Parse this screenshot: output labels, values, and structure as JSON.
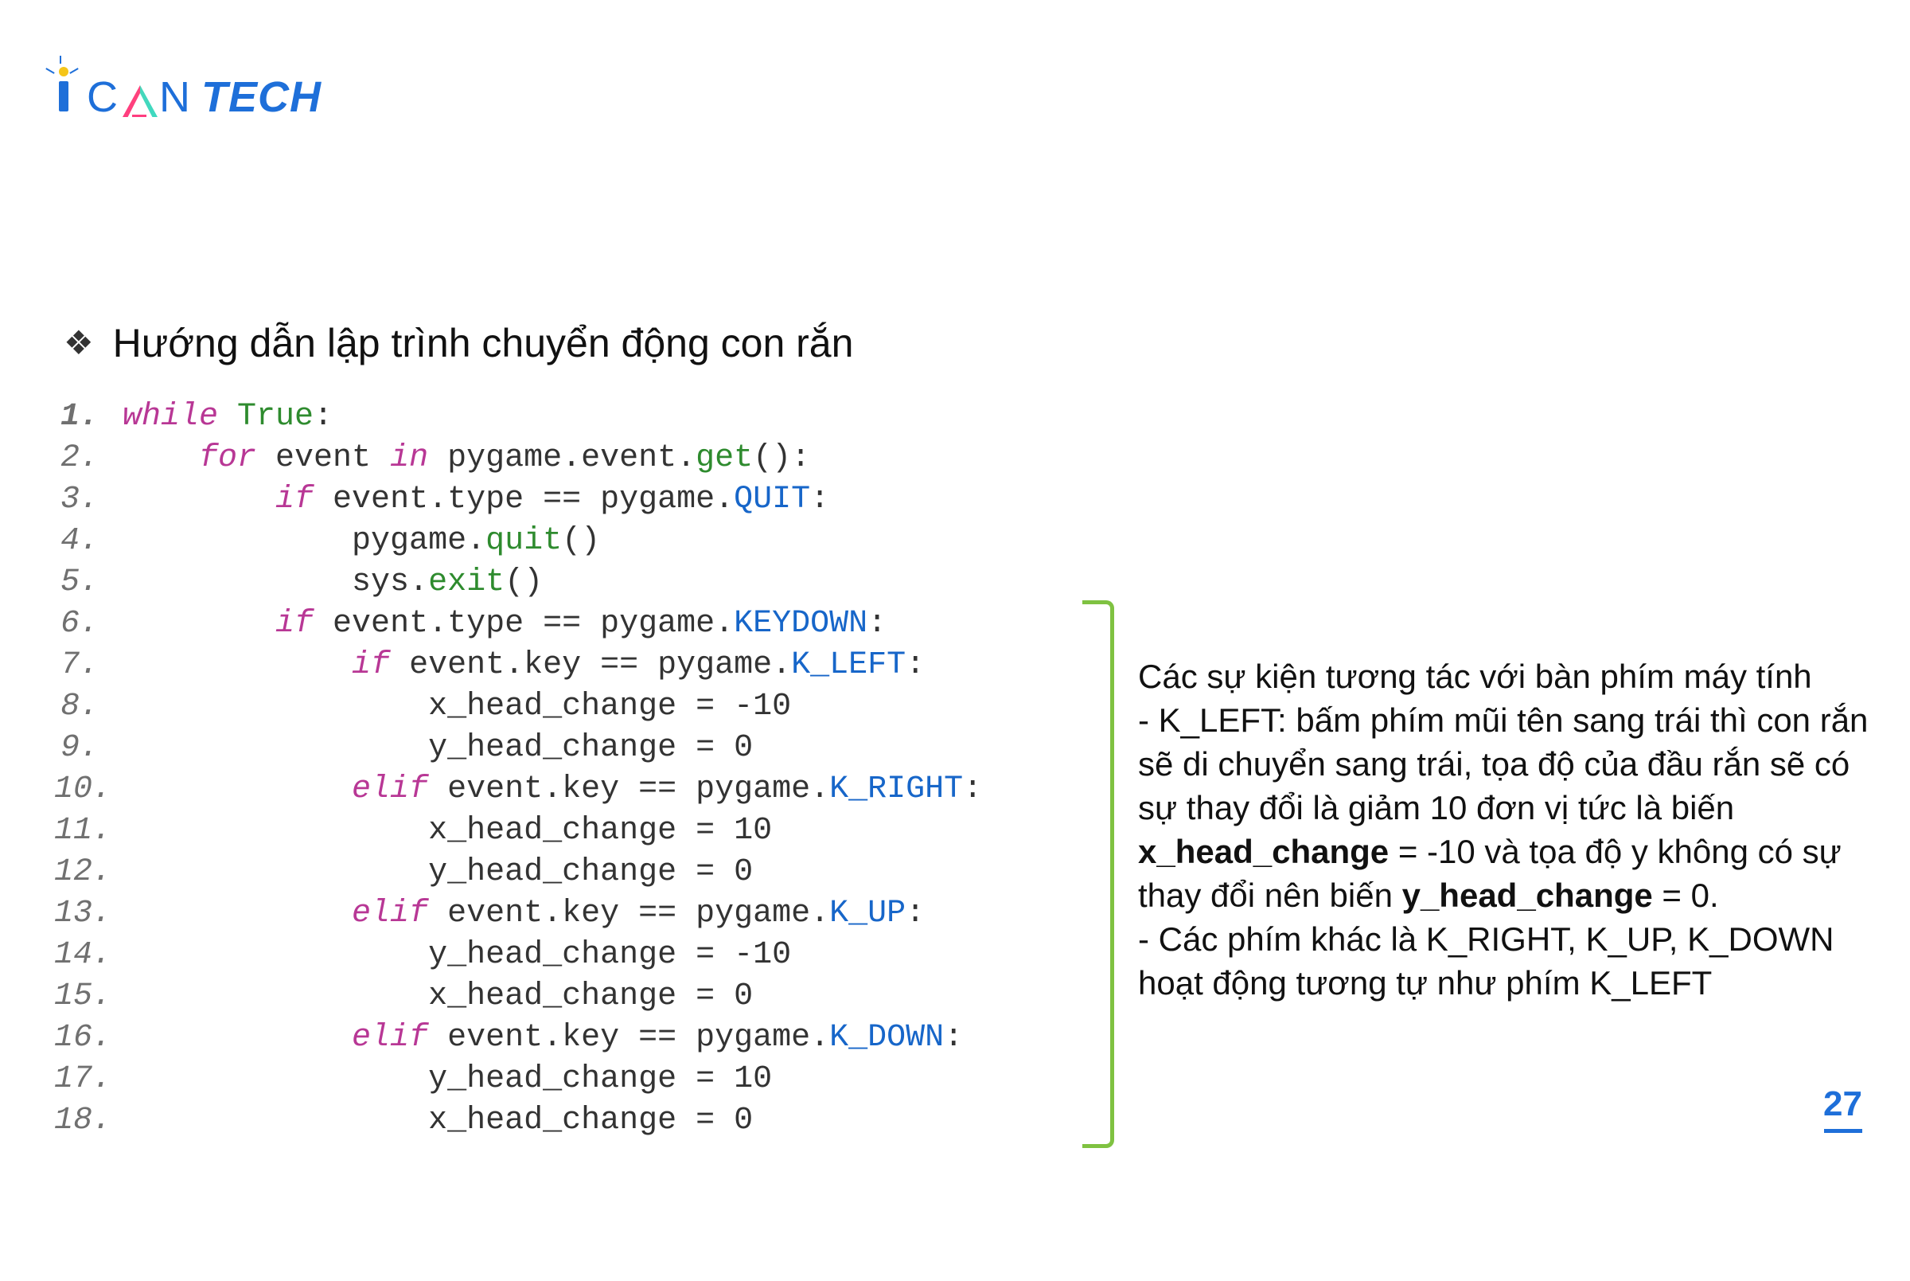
{
  "logo": {
    "can": "CAN",
    "tech": "TECH"
  },
  "heading": "Hướng dẫn lập trình chuyển động con rắn",
  "code": {
    "lines": [
      {
        "n": "1.",
        "bold": true,
        "tokens": [
          [
            "kw",
            "while"
          ],
          [
            "",
            " "
          ],
          [
            "bool",
            "True"
          ],
          [
            "",
            ":"
          ]
        ]
      },
      {
        "n": "2.",
        "bold": false,
        "tokens": [
          [
            "",
            "    "
          ],
          [
            "kw",
            "for"
          ],
          [
            "",
            " event "
          ],
          [
            "kw",
            "in"
          ],
          [
            "",
            " pygame.event."
          ],
          [
            "fn",
            "get"
          ],
          [
            "",
            "():"
          ]
        ]
      },
      {
        "n": "3.",
        "bold": false,
        "tokens": [
          [
            "",
            "        "
          ],
          [
            "kw",
            "if"
          ],
          [
            "",
            " event.type == pygame."
          ],
          [
            "const",
            "QUIT"
          ],
          [
            "",
            ":"
          ]
        ]
      },
      {
        "n": "4.",
        "bold": false,
        "tokens": [
          [
            "",
            "            pygame."
          ],
          [
            "fn",
            "quit"
          ],
          [
            "",
            "()"
          ]
        ]
      },
      {
        "n": "5.",
        "bold": false,
        "tokens": [
          [
            "",
            "            sys."
          ],
          [
            "fn",
            "exit"
          ],
          [
            "",
            "()"
          ]
        ]
      },
      {
        "n": "6.",
        "bold": false,
        "tokens": [
          [
            "",
            "        "
          ],
          [
            "kw",
            "if"
          ],
          [
            "",
            " event.type == pygame."
          ],
          [
            "const",
            "KEYDOWN"
          ],
          [
            "",
            ":"
          ]
        ]
      },
      {
        "n": "7.",
        "bold": false,
        "tokens": [
          [
            "",
            "            "
          ],
          [
            "kw",
            "if"
          ],
          [
            "",
            " event.key == pygame."
          ],
          [
            "const",
            "K_LEFT"
          ],
          [
            "",
            ":"
          ]
        ]
      },
      {
        "n": "8.",
        "bold": false,
        "tokens": [
          [
            "",
            "                x_head_change = "
          ],
          [
            "num",
            "-10"
          ]
        ]
      },
      {
        "n": "9.",
        "bold": false,
        "tokens": [
          [
            "",
            "                y_head_change = "
          ],
          [
            "num",
            "0"
          ]
        ]
      },
      {
        "n": "10.",
        "bold": false,
        "tokens": [
          [
            "",
            "            "
          ],
          [
            "kw",
            "elif"
          ],
          [
            "",
            " event.key == pygame."
          ],
          [
            "const",
            "K_RIGHT"
          ],
          [
            "",
            ":"
          ]
        ]
      },
      {
        "n": "11.",
        "bold": false,
        "tokens": [
          [
            "",
            "                x_head_change = "
          ],
          [
            "num",
            "10"
          ]
        ]
      },
      {
        "n": "12.",
        "bold": false,
        "tokens": [
          [
            "",
            "                y_head_change = "
          ],
          [
            "num",
            "0"
          ]
        ]
      },
      {
        "n": "13.",
        "bold": false,
        "tokens": [
          [
            "",
            "            "
          ],
          [
            "kw",
            "elif"
          ],
          [
            "",
            " event.key == pygame."
          ],
          [
            "const",
            "K_UP"
          ],
          [
            "",
            ":"
          ]
        ]
      },
      {
        "n": "14.",
        "bold": false,
        "tokens": [
          [
            "",
            "                y_head_change = "
          ],
          [
            "num",
            "-10"
          ]
        ]
      },
      {
        "n": "15.",
        "bold": false,
        "tokens": [
          [
            "",
            "                x_head_change = "
          ],
          [
            "num",
            "0"
          ]
        ]
      },
      {
        "n": "16.",
        "bold": false,
        "tokens": [
          [
            "",
            "            "
          ],
          [
            "kw",
            "elif"
          ],
          [
            "",
            " event.key == pygame."
          ],
          [
            "const",
            "K_DOWN"
          ],
          [
            "",
            ":"
          ]
        ]
      },
      {
        "n": "17.",
        "bold": false,
        "tokens": [
          [
            "",
            "                y_head_change = "
          ],
          [
            "num",
            "10"
          ]
        ]
      },
      {
        "n": "18.",
        "bold": false,
        "tokens": [
          [
            "",
            "                x_head_change = "
          ],
          [
            "num",
            "0"
          ]
        ]
      }
    ]
  },
  "explain": {
    "p1": "Các sự kiện tương tác với bàn phím máy tính",
    "p2a": "- K_LEFT: bấm phím mũi tên sang trái thì con rắn sẽ di chuyển sang trái, tọa độ của đầu rắn sẽ có sự thay đổi là giảm 10 đơn vị tức là biến ",
    "p2b": "x_head_change",
    "p2c": " = -10 và tọa độ y không có sự thay đổi nên biến ",
    "p2d": "y_head_change",
    "p2e": " = 0.",
    "p3": "- Các phím khác là K_RIGHT, K_UP, K_DOWN hoạt động tương tự như phím K_LEFT"
  },
  "page": "27"
}
